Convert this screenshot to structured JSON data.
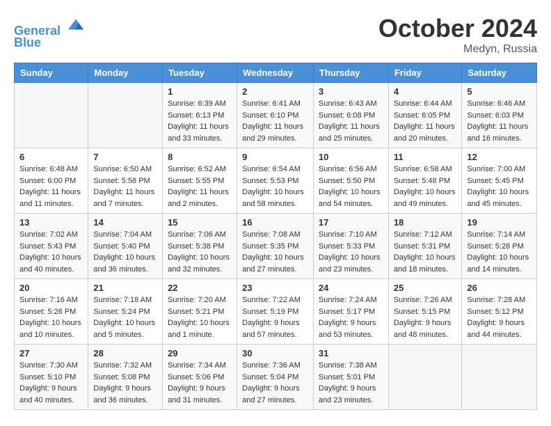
{
  "header": {
    "logo_line1": "General",
    "logo_line2": "Blue",
    "month_title": "October 2024",
    "location": "Medyn, Russia"
  },
  "days_of_week": [
    "Sunday",
    "Monday",
    "Tuesday",
    "Wednesday",
    "Thursday",
    "Friday",
    "Saturday"
  ],
  "weeks": [
    [
      {
        "day": "",
        "info": ""
      },
      {
        "day": "",
        "info": ""
      },
      {
        "day": "1",
        "info": "Sunrise: 6:39 AM\nSunset: 6:13 PM\nDaylight: 11 hours and 33 minutes."
      },
      {
        "day": "2",
        "info": "Sunrise: 6:41 AM\nSunset: 6:10 PM\nDaylight: 11 hours and 29 minutes."
      },
      {
        "day": "3",
        "info": "Sunrise: 6:43 AM\nSunset: 6:08 PM\nDaylight: 11 hours and 25 minutes."
      },
      {
        "day": "4",
        "info": "Sunrise: 6:44 AM\nSunset: 6:05 PM\nDaylight: 11 hours and 20 minutes."
      },
      {
        "day": "5",
        "info": "Sunrise: 6:46 AM\nSunset: 6:03 PM\nDaylight: 11 hours and 16 minutes."
      }
    ],
    [
      {
        "day": "6",
        "info": "Sunrise: 6:48 AM\nSunset: 6:00 PM\nDaylight: 11 hours and 11 minutes."
      },
      {
        "day": "7",
        "info": "Sunrise: 6:50 AM\nSunset: 5:58 PM\nDaylight: 11 hours and 7 minutes."
      },
      {
        "day": "8",
        "info": "Sunrise: 6:52 AM\nSunset: 5:55 PM\nDaylight: 11 hours and 2 minutes."
      },
      {
        "day": "9",
        "info": "Sunrise: 6:54 AM\nSunset: 5:53 PM\nDaylight: 10 hours and 58 minutes."
      },
      {
        "day": "10",
        "info": "Sunrise: 6:56 AM\nSunset: 5:50 PM\nDaylight: 10 hours and 54 minutes."
      },
      {
        "day": "11",
        "info": "Sunrise: 6:58 AM\nSunset: 5:48 PM\nDaylight: 10 hours and 49 minutes."
      },
      {
        "day": "12",
        "info": "Sunrise: 7:00 AM\nSunset: 5:45 PM\nDaylight: 10 hours and 45 minutes."
      }
    ],
    [
      {
        "day": "13",
        "info": "Sunrise: 7:02 AM\nSunset: 5:43 PM\nDaylight: 10 hours and 40 minutes."
      },
      {
        "day": "14",
        "info": "Sunrise: 7:04 AM\nSunset: 5:40 PM\nDaylight: 10 hours and 36 minutes."
      },
      {
        "day": "15",
        "info": "Sunrise: 7:06 AM\nSunset: 5:38 PM\nDaylight: 10 hours and 32 minutes."
      },
      {
        "day": "16",
        "info": "Sunrise: 7:08 AM\nSunset: 5:35 PM\nDaylight: 10 hours and 27 minutes."
      },
      {
        "day": "17",
        "info": "Sunrise: 7:10 AM\nSunset: 5:33 PM\nDaylight: 10 hours and 23 minutes."
      },
      {
        "day": "18",
        "info": "Sunrise: 7:12 AM\nSunset: 5:31 PM\nDaylight: 10 hours and 18 minutes."
      },
      {
        "day": "19",
        "info": "Sunrise: 7:14 AM\nSunset: 5:28 PM\nDaylight: 10 hours and 14 minutes."
      }
    ],
    [
      {
        "day": "20",
        "info": "Sunrise: 7:16 AM\nSunset: 5:26 PM\nDaylight: 10 hours and 10 minutes."
      },
      {
        "day": "21",
        "info": "Sunrise: 7:18 AM\nSunset: 5:24 PM\nDaylight: 10 hours and 5 minutes."
      },
      {
        "day": "22",
        "info": "Sunrise: 7:20 AM\nSunset: 5:21 PM\nDaylight: 10 hours and 1 minute."
      },
      {
        "day": "23",
        "info": "Sunrise: 7:22 AM\nSunset: 5:19 PM\nDaylight: 9 hours and 57 minutes."
      },
      {
        "day": "24",
        "info": "Sunrise: 7:24 AM\nSunset: 5:17 PM\nDaylight: 9 hours and 53 minutes."
      },
      {
        "day": "25",
        "info": "Sunrise: 7:26 AM\nSunset: 5:15 PM\nDaylight: 9 hours and 48 minutes."
      },
      {
        "day": "26",
        "info": "Sunrise: 7:28 AM\nSunset: 5:12 PM\nDaylight: 9 hours and 44 minutes."
      }
    ],
    [
      {
        "day": "27",
        "info": "Sunrise: 7:30 AM\nSunset: 5:10 PM\nDaylight: 9 hours and 40 minutes."
      },
      {
        "day": "28",
        "info": "Sunrise: 7:32 AM\nSunset: 5:08 PM\nDaylight: 9 hours and 36 minutes."
      },
      {
        "day": "29",
        "info": "Sunrise: 7:34 AM\nSunset: 5:06 PM\nDaylight: 9 hours and 31 minutes."
      },
      {
        "day": "30",
        "info": "Sunrise: 7:36 AM\nSunset: 5:04 PM\nDaylight: 9 hours and 27 minutes."
      },
      {
        "day": "31",
        "info": "Sunrise: 7:38 AM\nSunset: 5:01 PM\nDaylight: 9 hours and 23 minutes."
      },
      {
        "day": "",
        "info": ""
      },
      {
        "day": "",
        "info": ""
      }
    ]
  ]
}
